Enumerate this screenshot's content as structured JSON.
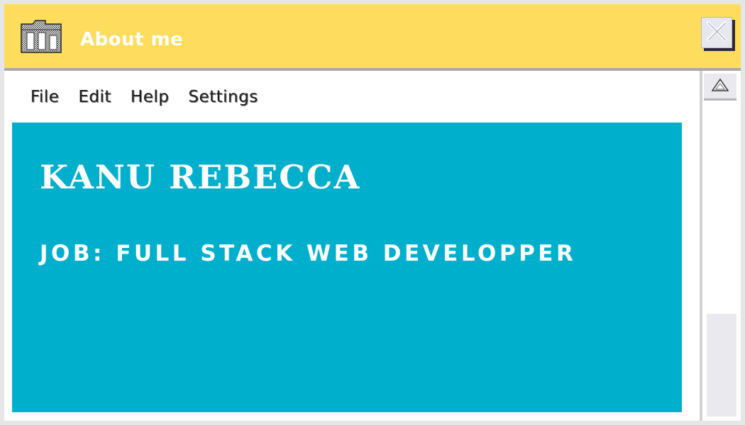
{
  "window": {
    "title": "About me",
    "colors": {
      "titlebar": "#fedd5e",
      "content": "#00afcc",
      "text": "#ffffff"
    }
  },
  "menu": {
    "items": [
      {
        "label": "File"
      },
      {
        "label": "Edit"
      },
      {
        "label": "Help"
      },
      {
        "label": "Settings"
      }
    ]
  },
  "content": {
    "name": "KANU REBECCA",
    "job": "JOB: FULL STACK WEB DEVELOPPER"
  },
  "icons": {
    "title": "folder-icon",
    "close": "close-icon",
    "scroll_up": "scroll-up-icon"
  }
}
